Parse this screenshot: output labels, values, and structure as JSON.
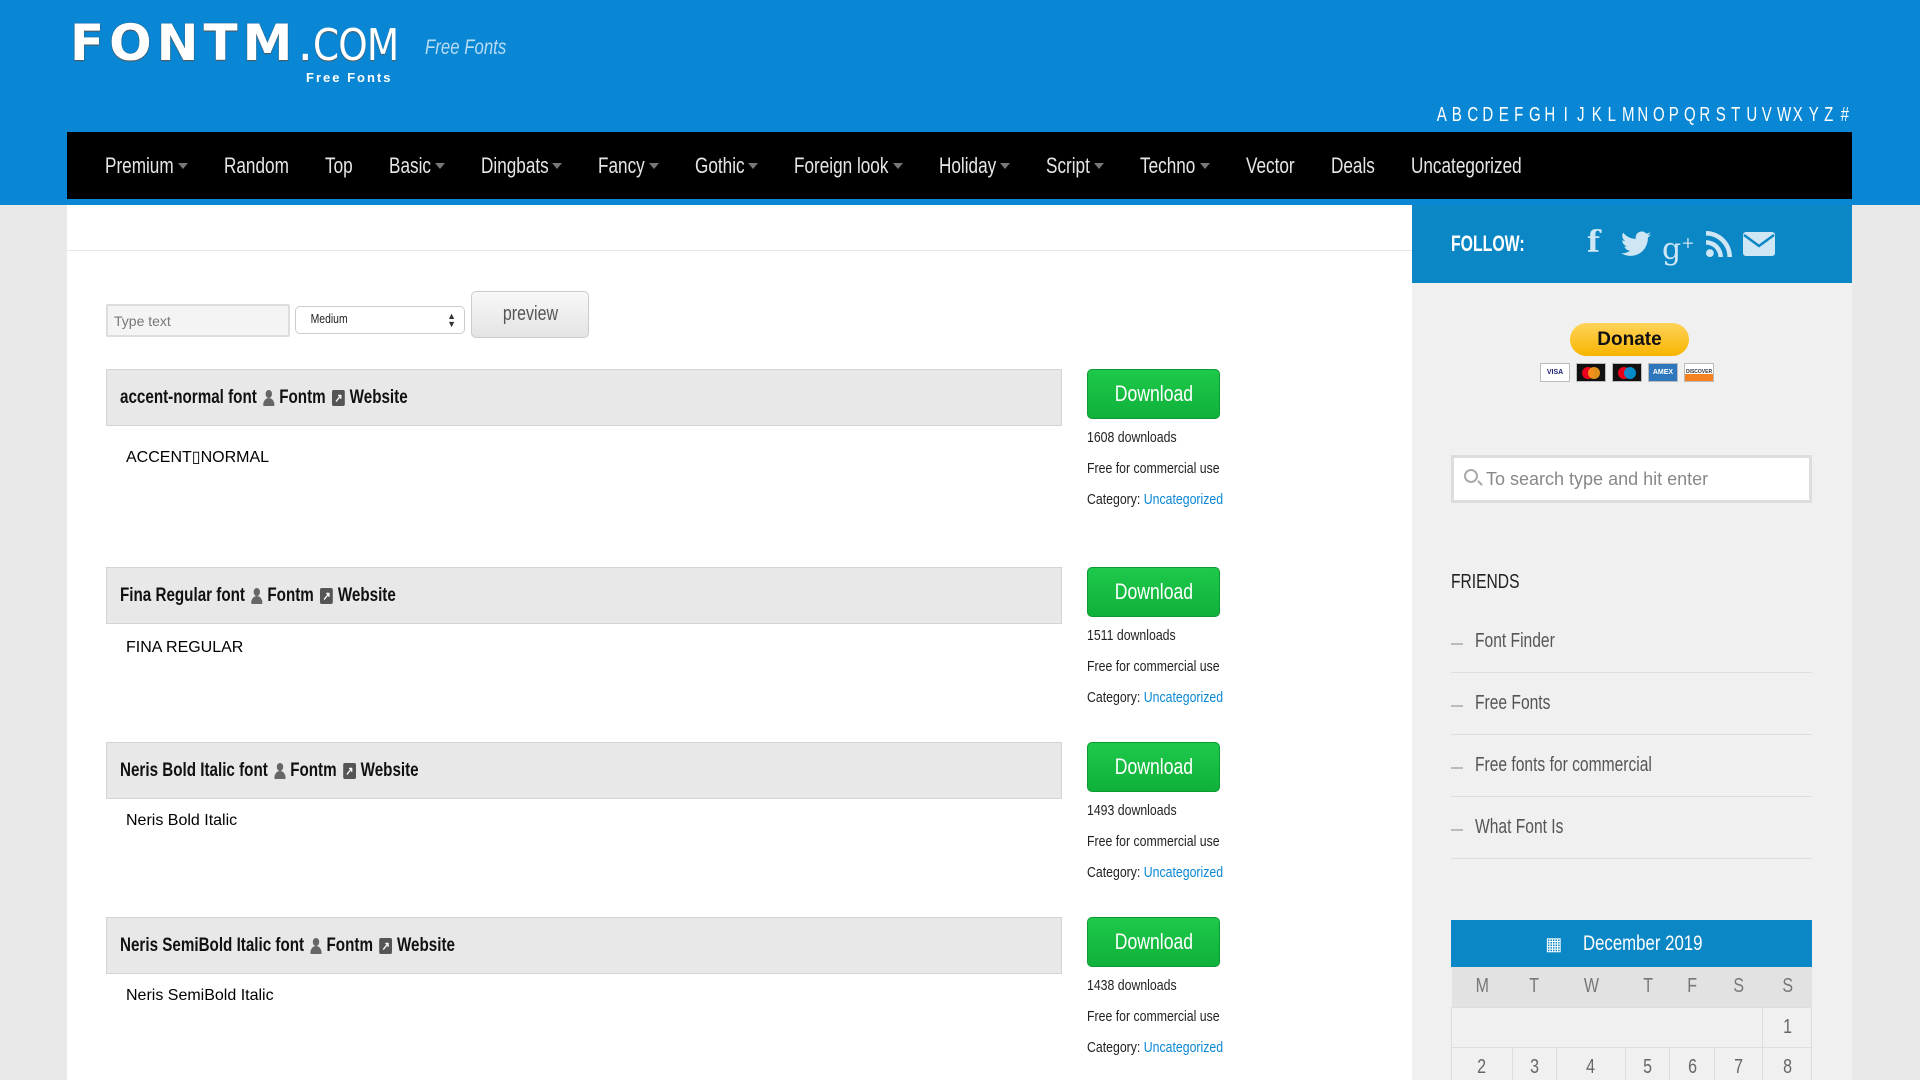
{
  "header": {
    "logo_main": "FONTM",
    "logo_dot": ".",
    "logo_com": "COM",
    "logo_sub": "Free Fonts",
    "tagline": "Free Fonts",
    "alphabet": [
      "A",
      "B",
      "C",
      "D",
      "E",
      "F",
      "G",
      "H",
      "I",
      "J",
      "K",
      "L",
      "M",
      "N",
      "O",
      "P",
      "Q",
      "R",
      "S",
      "T",
      "U",
      "V",
      "W",
      "X",
      "Y",
      "Z",
      "#"
    ]
  },
  "nav": {
    "items": [
      {
        "label": "Premium",
        "dropdown": true
      },
      {
        "label": "Random",
        "dropdown": false
      },
      {
        "label": "Top",
        "dropdown": false
      },
      {
        "label": "Basic",
        "dropdown": true
      },
      {
        "label": "Dingbats",
        "dropdown": true
      },
      {
        "label": "Fancy",
        "dropdown": true
      },
      {
        "label": "Gothic",
        "dropdown": true
      },
      {
        "label": "Foreign look",
        "dropdown": true
      },
      {
        "label": "Holiday",
        "dropdown": true
      },
      {
        "label": "Script",
        "dropdown": true
      },
      {
        "label": "Techno",
        "dropdown": true
      },
      {
        "label": "Vector",
        "dropdown": false
      },
      {
        "label": "Deals",
        "dropdown": false
      },
      {
        "label": "Uncategorized",
        "dropdown": false
      }
    ]
  },
  "controls": {
    "type_text_placeholder": "Type text",
    "size_selected": "Medium",
    "preview_label": "preview"
  },
  "fonts": [
    {
      "title": "accent-normal font",
      "author": "Fontm",
      "website": "Website",
      "preview_text": "ACCENT▯NORMAL",
      "download_label": "Download",
      "downloads": "1608 downloads",
      "license": "Free for commercial use",
      "category_label": "Category:",
      "category": "Uncategorized"
    },
    {
      "title": "Fina Regular font",
      "author": "Fontm",
      "website": "Website",
      "preview_text": "FINA REGULAR",
      "download_label": "Download",
      "downloads": "1511 downloads",
      "license": "Free for commercial use",
      "category_label": "Category:",
      "category": "Uncategorized"
    },
    {
      "title": "Neris Bold Italic font",
      "author": "Fontm",
      "website": "Website",
      "preview_text": "Neris Bold Italic",
      "download_label": "Download",
      "downloads": "1493 downloads",
      "license": "Free for commercial use",
      "category_label": "Category:",
      "category": "Uncategorized"
    },
    {
      "title": "Neris SemiBold Italic font",
      "author": "Fontm",
      "website": "Website",
      "preview_text": "Neris SemiBold Italic",
      "download_label": "Download",
      "downloads": "1438 downloads",
      "license": "Free for commercial use",
      "category_label": "Category:",
      "category": "Uncategorized"
    }
  ],
  "sidebar": {
    "follow_label": "FOLLOW:",
    "social": [
      "facebook",
      "twitter",
      "google-plus",
      "rss",
      "email"
    ],
    "donate_label": "Donate",
    "cards": [
      "VISA",
      "mastercard",
      "maestro",
      "AMEX",
      "DISCOVER"
    ],
    "search_placeholder": "To search type and hit enter",
    "friends_title": "FRIENDS",
    "friends": [
      "Font Finder",
      "Free Fonts",
      "Free fonts for commercial",
      "What Font Is"
    ],
    "calendar": {
      "title": "December 2019",
      "weekdays": [
        "M",
        "T",
        "W",
        "T",
        "F",
        "S",
        "S"
      ],
      "week1": [
        "",
        "",
        "",
        "",
        "",
        "",
        "1"
      ],
      "week2": [
        "2",
        "3",
        "4",
        "5",
        "6",
        "7",
        "8"
      ]
    }
  },
  "colors": {
    "brand_blue": "#0a87d4",
    "sidebar_blue": "#0a87c4",
    "download_green": "#16be41",
    "link_blue": "#0a87d4"
  }
}
